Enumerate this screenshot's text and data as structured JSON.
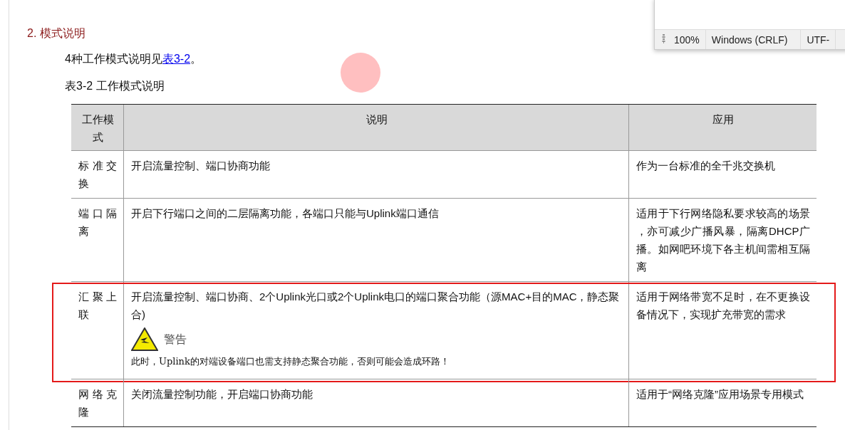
{
  "heading": "2. 模式说明",
  "intro": {
    "text": "4种工作模式说明见",
    "link": "表3-2",
    "after": "。"
  },
  "caption": "表3-2 工作模式说明",
  "table": {
    "columns": [
      "工作模式",
      "说明",
      "应用"
    ],
    "rows": [
      {
        "mode": "标准交换",
        "description": "开启流量控制、端口协商功能",
        "application": "作为一台标准的全千兆交换机",
        "highlighted": false
      },
      {
        "mode": "端口隔离",
        "description": "开启下行端口之间的二层隔离功能，各端口只能与Uplink端口通信",
        "application": "适用于下行网络隐私要求较高的场景，亦可减少广播风暴，隔离DHCP广播。如网吧环境下各主机间需相互隔离",
        "highlighted": false
      },
      {
        "mode": "汇聚上联",
        "description": "开启流量控制、端口协商、2个Uplink光口或2个Uplink电口的端口聚合功能（源MAC+目的MAC，静态聚合)",
        "warning": {
          "title": "警告",
          "text": "此时，Uplink的对端设备端口也需支持静态聚合功能，否则可能会造成环路！"
        },
        "application": "适用于网络带宽不足时，在不更换设备情况下，实现扩充带宽的需求",
        "highlighted": true
      },
      {
        "mode": "网络克隆",
        "description": "关闭流量控制功能，开启端口协商功能",
        "application": "适用于“网络克隆”应用场景专用模式",
        "highlighted": false
      }
    ]
  },
  "notepad": {
    "status_bar": [
      "100%",
      "Windows (CRLF)",
      "UTF-"
    ]
  }
}
